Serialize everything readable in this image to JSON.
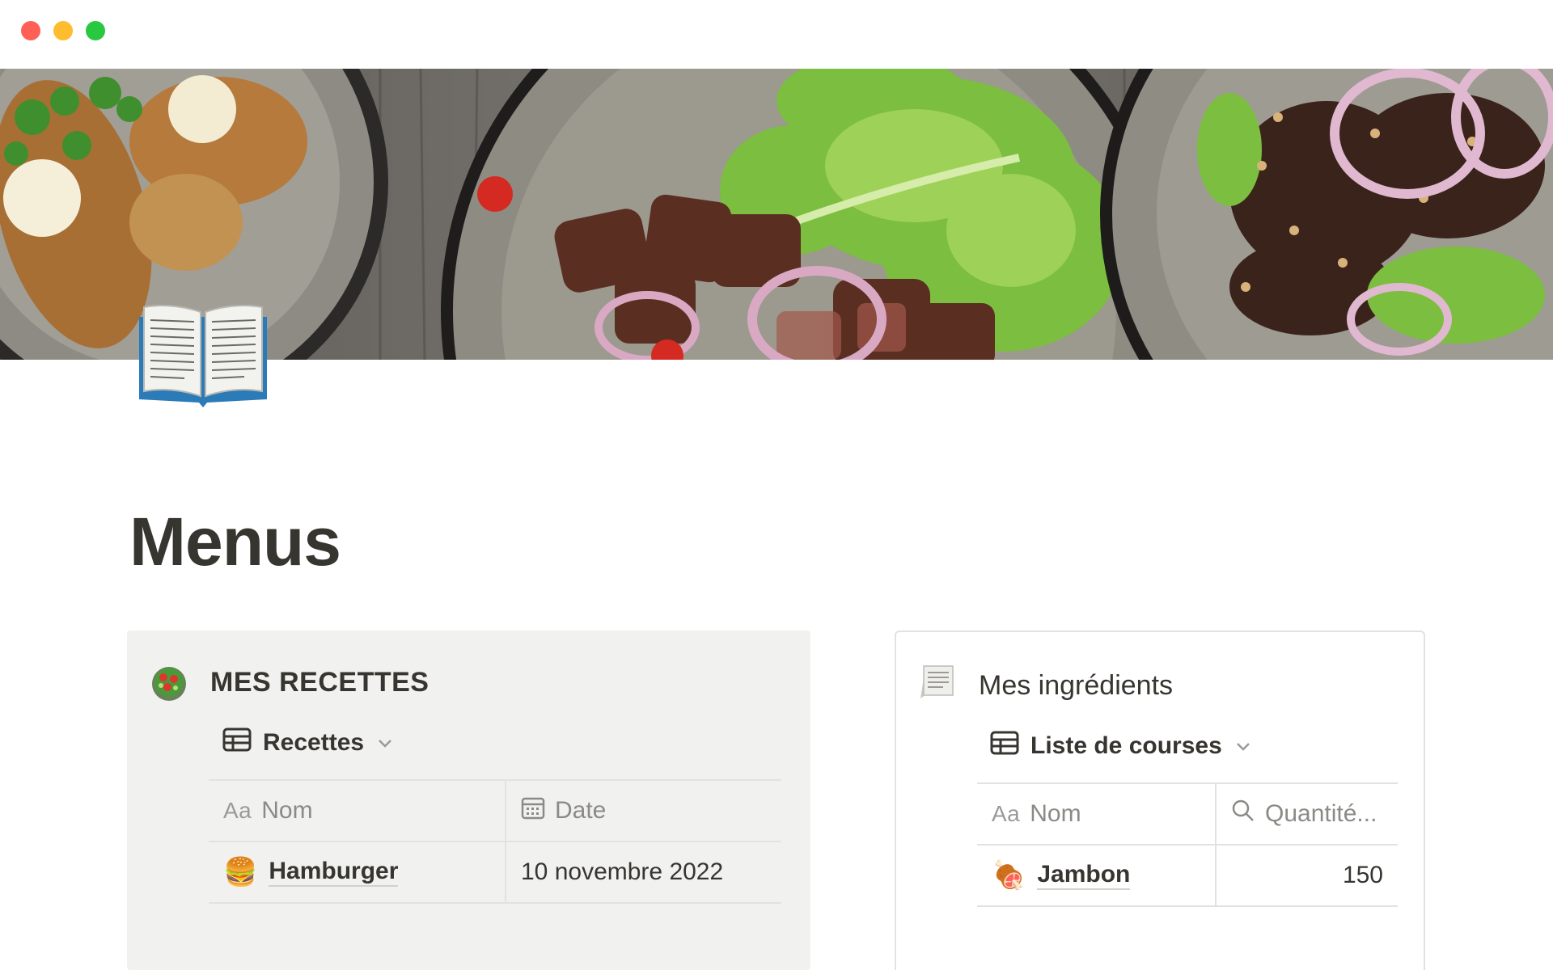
{
  "window": {
    "controls": [
      "close",
      "minimize",
      "maximize"
    ]
  },
  "page": {
    "title": "Menus",
    "icon": "open-book-icon",
    "cover": "food-plates-photo"
  },
  "recipes": {
    "title": "MES RECETTES",
    "icon": "salad-icon",
    "view_label": "Recettes",
    "view_icon": "table-icon",
    "columns": [
      {
        "label": "Nom",
        "prefix": "Aa"
      },
      {
        "label": "Date",
        "icon": "calendar-icon"
      }
    ],
    "rows": [
      {
        "emoji": "🍔",
        "name": "Hamburger",
        "date": "10 novembre 2022"
      }
    ]
  },
  "ingredients": {
    "title": "Mes ingrédients",
    "icon": "receipt-icon",
    "view_label": "Liste de courses",
    "view_icon": "table-icon",
    "columns": [
      {
        "label": "Nom",
        "prefix": "Aa"
      },
      {
        "label": "Quantité...",
        "icon": "search-icon"
      }
    ],
    "rows": [
      {
        "emoji": "🍖",
        "name": "Jambon",
        "quantity": "150"
      }
    ]
  },
  "colors": {
    "text": "#37352f",
    "muted": "#9b9a97",
    "callout_bg": "#f1f1ef",
    "border": "#e3e2e0"
  }
}
